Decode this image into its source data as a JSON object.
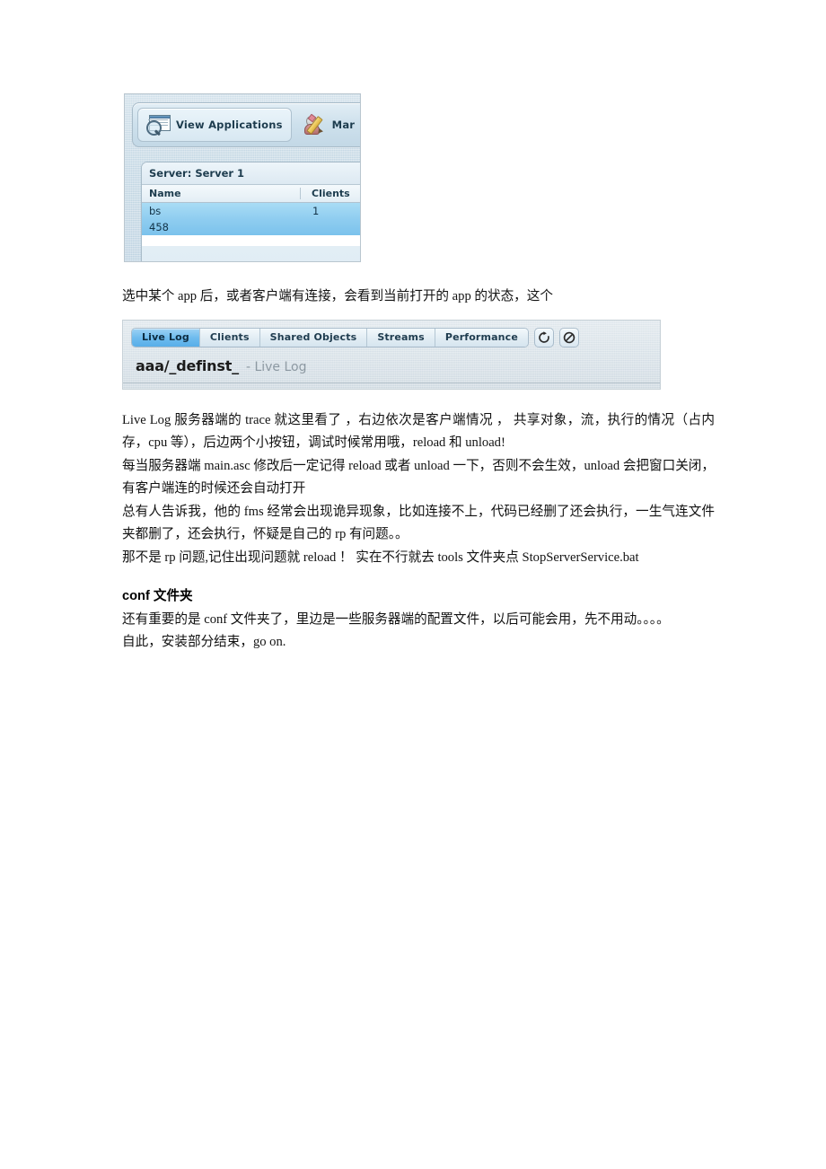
{
  "document": {
    "language": "zh-CN"
  },
  "screenshot_admin_console": {
    "name": "fms-administration-console",
    "toolbar": {
      "view_applications_label": "View Applications",
      "manage_users_label": "Mar",
      "view_applications_icon": "window-magnifier-icon",
      "manage_users_icon": "user-pencil-icon"
    },
    "panel": {
      "server_selector_label": "Server: Server 1",
      "server_selector_icon": "chevron-down-icon",
      "columns": [
        "Name",
        "Clients"
      ],
      "sort_icon": "caret-up-icon",
      "rows": [
        {
          "name": "bs",
          "clients": "1"
        },
        {
          "name": "458",
          "clients": ""
        }
      ]
    }
  },
  "paragraph_intro": "选中某个 app 后，或者客户端有连接，会看到当前打开的 app 的状态，这个",
  "screenshot_live_log": {
    "name": "fms-application-inspector",
    "tabs": [
      {
        "label": "Live Log",
        "active": true
      },
      {
        "label": "Clients",
        "active": false
      },
      {
        "label": "Shared Objects",
        "active": false
      },
      {
        "label": "Streams",
        "active": false
      },
      {
        "label": "Performance",
        "active": false
      }
    ],
    "actions": [
      {
        "name": "reload-button",
        "icon": "refresh-icon"
      },
      {
        "name": "unload-button",
        "icon": "no-entry-icon"
      }
    ],
    "header": {
      "title": "aaa/_definst_",
      "subtitle": "- Live Log"
    }
  },
  "body": {
    "p1": "Live Log 服务器端的 trace 就这里看了 ，右边依次是客户端情况 ， 共享对象，流，执行的情况（占内存，cpu 等），后边两个小按钮，调试时候常用哦，reload 和 unload!",
    "p2": "每当服务器端 main.asc 修改后一定记得 reload 或者 unload 一下，否则不会生效，unload 会把窗口关闭，有客户端连的时候还会自动打开",
    "p3": "总有人告诉我，他的 fms 经常会出现诡异现象，比如连接不上，代码已经删了还会执行，一生气连文件夹都删了，还会执行，怀疑是自己的 rp 有问题。。",
    "p4": "那不是 rp 问题,记住出现问题就 reload ！ 实在不行就去 tools 文件夹点 StopServerService.bat",
    "heading_conf": "conf 文件夹",
    "p5": "还有重要的是 conf 文件夹了，里边是一些服务器端的配置文件，以后可能会用，先不用动。。。。",
    "p6": "自此，安装部分结束，go on."
  }
}
